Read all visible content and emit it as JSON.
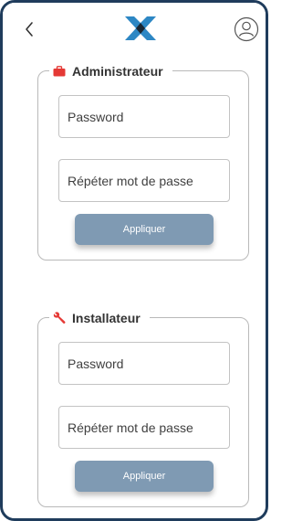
{
  "header": {
    "back_icon": "chevron-left-icon",
    "logo_icon": "brand-logo-icon",
    "profile_icon": "user-profile-icon"
  },
  "colors": {
    "frame_border": "#1f3c5c",
    "logo_blue": "#2d87c4",
    "logo_dark": "#1b2733",
    "button_bg": "#7f9ab3",
    "admin_icon": "#e53935",
    "installer_icon": "#e53935"
  },
  "sections": {
    "admin": {
      "title": "Administrateur",
      "icon": "briefcase-icon",
      "password_placeholder": "Password",
      "confirm_placeholder": "Répéter mot de passe",
      "apply_label": "Appliquer"
    },
    "installer": {
      "title": "Installateur",
      "icon": "wrench-icon",
      "password_placeholder": "Password",
      "confirm_placeholder": "Répéter mot de passe",
      "apply_label": "Appliquer"
    }
  }
}
